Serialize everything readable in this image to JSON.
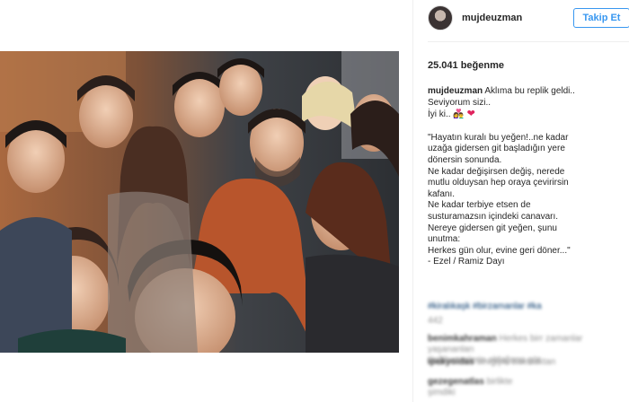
{
  "post": {
    "username": "mujdeuzman",
    "follow_label": "Takip Et",
    "likes": "25.041 beğenme",
    "caption": {
      "author": "mujdeuzman",
      "line1": "Aklıma bu replik geldi..",
      "line2": "Seviyorum sizi..",
      "line3": "İyi ki..",
      "quote_lines": [
        "\"Hayatın kuralı bu yeğen!..ne kadar",
        "uzağa gidersen git başladığın yere",
        "dönersin sonunda.",
        "Ne kadar değişirsen değiş, nerede",
        "mutlu olduysan hep oraya çevirirsin",
        "kafanı.",
        "Ne kadar terbiye etsen de",
        "susturamazsın içindeki canavarı.",
        "Nereye gidersen git yeğen, şunu",
        "unutma:",
        "Herkes gün olur, evine geri döner...\"",
        "- Ezel / Ramiz Dayı"
      ]
    },
    "blurred_comments": {
      "hashtags": "#kiralıkaşk #birzamanlar #ka",
      "count": "442",
      "c1_user": "benimkahraman",
      "c1_text": "Herkes birr zamanlar yaşananları",
      "c1_text2": "değilse nelerin olduğunu gör",
      "c2_user": "ipekyoldas",
      "c2_text": "sevgiyle bakmaktan",
      "c3_user": "gezegenatlas",
      "c3_text": "birlikte",
      "c4_text": "şimdiki"
    }
  },
  "colors": {
    "link": "#3897f0",
    "heart": "#e0245e",
    "text": "#262626",
    "muted": "#8e8e8e"
  },
  "icons": [
    "avatar-image",
    "heart-icon",
    "couple-emoji-icon"
  ]
}
